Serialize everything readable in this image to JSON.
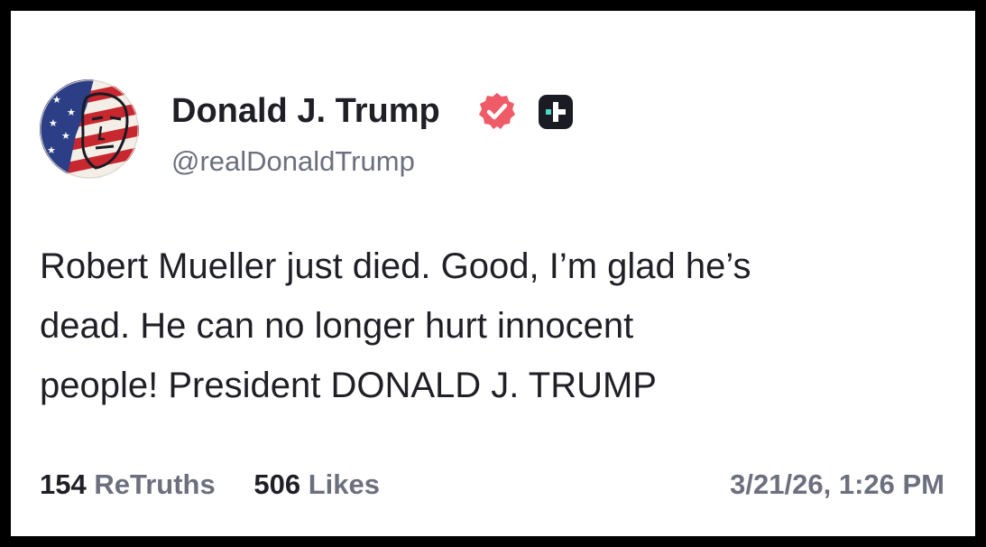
{
  "profile": {
    "display_name": "Donald J. Trump",
    "handle": "@realDonaldTrump",
    "avatar_icon": "flag-portrait-avatar",
    "verified_icon": "verified-badge-icon",
    "plus_icon": "plus-badge-icon"
  },
  "post": {
    "lines": [
      "Robert Mueller just died. Good, I’m glad he’s",
      "dead. He can no longer hurt innocent",
      "people! President DONALD J. TRUMP"
    ]
  },
  "stats": {
    "retruths_count": "154",
    "retruths_label": "ReTruths",
    "likes_count": "506",
    "likes_label": "Likes"
  },
  "timestamp": "3/21/26, 1:26 PM",
  "colors": {
    "text_primary": "#1f1f26",
    "text_secondary": "#6c6f7d",
    "verified_badge": "#ef5b67",
    "plus_badge": "#1b1b24",
    "plus_accent": "#4fd6c4",
    "frame": "#000000"
  }
}
